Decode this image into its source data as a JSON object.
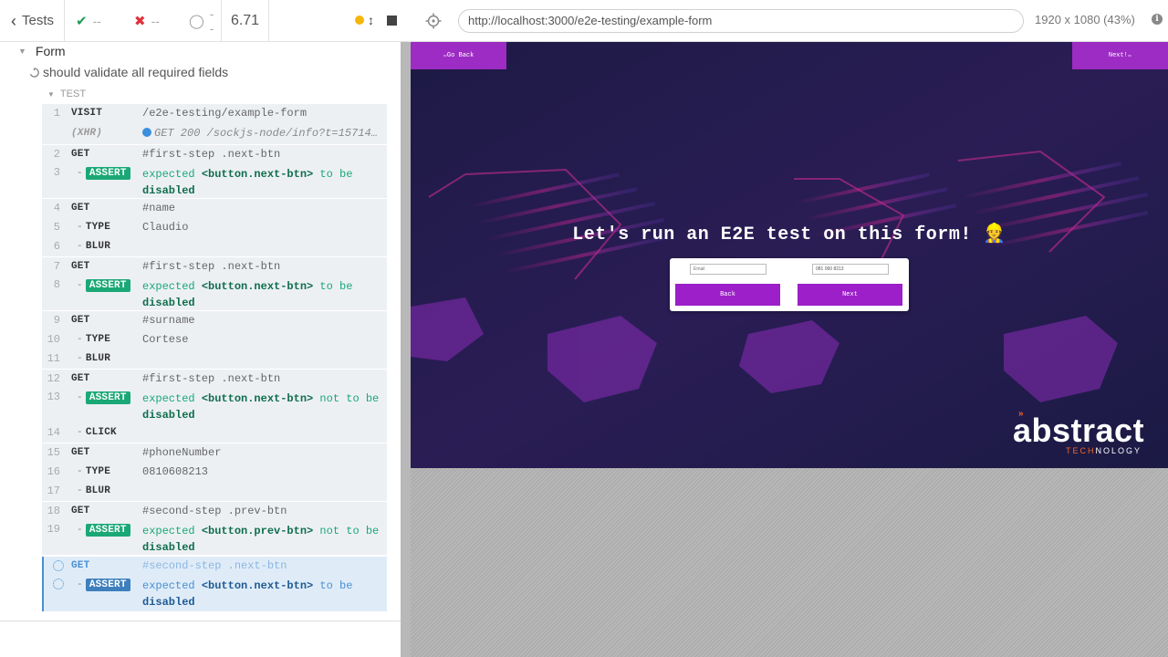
{
  "stats": {
    "tests_label": "Tests",
    "passed": "--",
    "failed": "--",
    "pending": "--",
    "duration": "6.71"
  },
  "suite": {
    "title": "Form",
    "test_title": "should validate all required fields",
    "group_label": "TEST"
  },
  "commands": [
    {
      "num": "1",
      "name": "VISIT",
      "msg": "/e2e-testing/example-form"
    },
    {
      "num": "",
      "name": "(XHR)",
      "msg": "GET 200 /sockjs-node/info?t=15714…"
    },
    {
      "num": "2",
      "name": "GET",
      "msg": "#first-step .next-btn"
    },
    {
      "num": "3",
      "name": "ASSERT",
      "pre": "expected ",
      "subject": "<button.next-btn>",
      "mid": " to be ",
      "end": "disabled"
    },
    {
      "num": "4",
      "name": "GET",
      "msg": "#name"
    },
    {
      "num": "5",
      "name": "TYPE",
      "msg": "Claudio"
    },
    {
      "num": "6",
      "name": "BLUR",
      "msg": ""
    },
    {
      "num": "7",
      "name": "GET",
      "msg": "#first-step .next-btn"
    },
    {
      "num": "8",
      "name": "ASSERT",
      "pre": "expected ",
      "subject": "<button.next-btn>",
      "mid": " to be ",
      "end": "disabled"
    },
    {
      "num": "9",
      "name": "GET",
      "msg": "#surname"
    },
    {
      "num": "10",
      "name": "TYPE",
      "msg": "Cortese"
    },
    {
      "num": "11",
      "name": "BLUR",
      "msg": ""
    },
    {
      "num": "12",
      "name": "GET",
      "msg": "#first-step .next-btn"
    },
    {
      "num": "13",
      "name": "ASSERT",
      "pre": "expected ",
      "subject": "<button.next-btn>",
      "mid": " not to be ",
      "end": "disabled"
    },
    {
      "num": "14",
      "name": "CLICK",
      "msg": ""
    },
    {
      "num": "15",
      "name": "GET",
      "msg": "#phoneNumber"
    },
    {
      "num": "16",
      "name": "TYPE",
      "msg": "0810608213"
    },
    {
      "num": "17",
      "name": "BLUR",
      "msg": ""
    },
    {
      "num": "18",
      "name": "GET",
      "msg": "#second-step .prev-btn"
    },
    {
      "num": "19",
      "name": "ASSERT",
      "pre": "expected ",
      "subject": "<button.prev-btn>",
      "mid": " not to be ",
      "end": "disabled"
    },
    {
      "num": "",
      "name": "GET",
      "msg": "#second-step .next-btn"
    },
    {
      "num": "",
      "name": "ASSERT",
      "pre": "expected ",
      "subject": "<button.next-btn>",
      "mid": " to be ",
      "end": "disabled"
    }
  ],
  "aut": {
    "url": "http://localhost:3000/e2e-testing/example-form",
    "viewport": "1920 x 1080  (43%)",
    "go_back": "Go Back",
    "next_top": "Next!",
    "heading": "Let's run an E2E test on this form! 👷",
    "email_placeholder": "Email",
    "phone_value": "081 060 8213",
    "back_btn": "Back",
    "next_btn": "Next",
    "brand_word": "abstract",
    "brand_tag_1": "TECH",
    "brand_tag_2": "NOLOGY"
  },
  "colors": {
    "pass": "#1aa876",
    "fail": "#e0313c",
    "brand_purple": "#9c2cc3",
    "brand_orange": "#f26522"
  }
}
